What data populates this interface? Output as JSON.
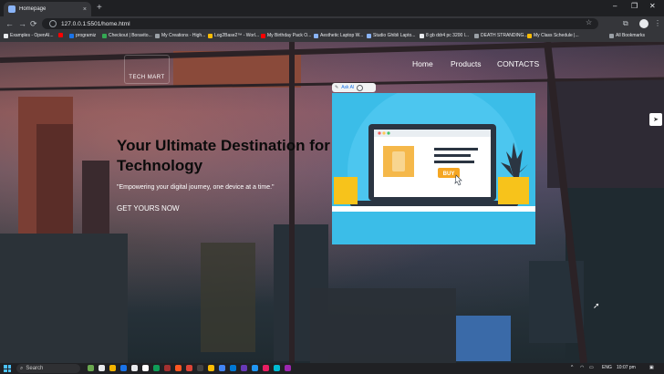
{
  "browser": {
    "tab_title": "Homepage",
    "tab_close": "×",
    "new_tab": "+",
    "url": "127.0.0.1:5501/home.html",
    "window_controls": [
      "–",
      "❐",
      "✕"
    ],
    "nav": {
      "back": "←",
      "forward": "→",
      "reload": "⟳"
    },
    "icons": {
      "star": "☆",
      "extensions": "⧉",
      "menu": "⋮"
    },
    "bookmarks": [
      {
        "label": "Examples - OpenAI...",
        "color": "#e8eaed"
      },
      {
        "label": "",
        "color": "#ff0000"
      },
      {
        "label": "programiz",
        "color": "#1a73e8"
      },
      {
        "label": "Checkout | Boravito...",
        "color": "#34a853"
      },
      {
        "label": "My Creations - High...",
        "color": "#9aa0a6"
      },
      {
        "label": "Log2Base2™ - Worl...",
        "color": "#fbbc04"
      },
      {
        "label": "My Birthday Pack O...",
        "color": "#ff0000"
      },
      {
        "label": "Aesthetic Laptop W...",
        "color": "#8ab4f8"
      },
      {
        "label": "Studio Ghibli Lapto...",
        "color": "#8ab4f8"
      },
      {
        "label": "8 gb ddr4 pc 3200 l...",
        "color": "#e8eaed"
      },
      {
        "label": "DEATH STRANDING...",
        "color": "#9aa0a6"
      },
      {
        "label": "My Class Schedule |...",
        "color": "#fbbc04"
      }
    ],
    "all_bookmarks": "All Bookmarks"
  },
  "site": {
    "logo": "TECH MART",
    "nav": [
      "Home",
      "Products",
      "CONTACTS"
    ],
    "hero_title": "Your Ultimate Destination for Technology",
    "hero_subtitle": "\"Empowering your digital journey, one device at a time.\"",
    "cta": "GET YOURS NOW",
    "ask_ai": "Ask AI",
    "image_button": "BUY"
  },
  "taskbar": {
    "search": "Search",
    "lang": "ENG",
    "time": "10:07 pm"
  },
  "colors": {
    "browser_bg": "#35363a",
    "accent": "#1a73e8",
    "image_bg": "#3bbde8",
    "laptop_screen": "#2ba7d6",
    "buy_button": "#f5a623"
  }
}
